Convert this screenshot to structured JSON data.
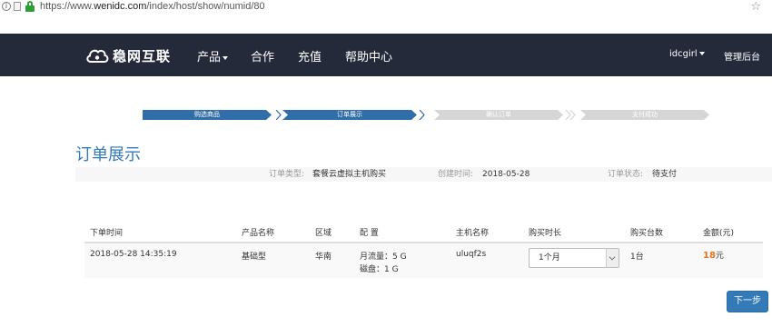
{
  "browser": {
    "url_prefix": "https://www.",
    "url_domain": "wenidc.com",
    "url_path": "/index/host/show/numid/80"
  },
  "navbar": {
    "logo_text": "稳网互联",
    "items": [
      {
        "label": "产品"
      },
      {
        "label": "合作"
      },
      {
        "label": "充值"
      },
      {
        "label": "帮助中心"
      }
    ],
    "user": "idcgirl",
    "admin": "管理后台"
  },
  "steps": {
    "items": [
      {
        "label": "购选商品",
        "active": true
      },
      {
        "label": "订单展示",
        "active": true
      },
      {
        "label": "确认订单",
        "active": false
      },
      {
        "label": "支付成功",
        "active": false
      }
    ],
    "active_color": "#2f6ea8",
    "inactive_color": "#d6d6d6"
  },
  "page_title": "订单展示",
  "order_info": {
    "type_label": "订单类型:",
    "type_value": "套餐云虚拟主机购买",
    "created_label": "创建时间:",
    "created_value": "2018-05-28",
    "status_label": "订单状态:",
    "status_value": "待支付"
  },
  "table": {
    "headers": [
      "下单时间",
      "产品名称",
      "区域",
      "配 置",
      "主机名称",
      "购买时长",
      "购买台数",
      "金额(元)"
    ],
    "row": {
      "time": "2018-05-28 14:35:19",
      "product": "基础型",
      "region": "华南",
      "config_traffic": "月流量：5 G",
      "config_disk": "磁盘：1 G",
      "host": "uluqf2s",
      "duration": "1个月",
      "count": "1台",
      "price": "18",
      "price_unit": "元"
    }
  },
  "next_button": "下一步",
  "accent_color": "#337ab7",
  "price_color": "#e8711b"
}
